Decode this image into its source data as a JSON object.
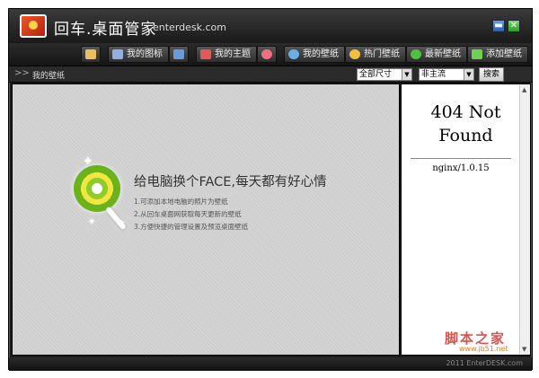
{
  "app": {
    "title": "回车.桌面管家",
    "domain": "enterdesk.com",
    "minimize_label": "▬",
    "close_label": "✕"
  },
  "toolbar": {
    "buttons": [
      {
        "label": "",
        "icon": "folder-icon",
        "color": "#e8c060"
      },
      {
        "label": "我的图标",
        "icon": "grid-icon",
        "color": "#8fb0e0"
      },
      {
        "label": "",
        "icon": "image-icon",
        "color": "#6a9ad8"
      },
      {
        "label": "我的主题",
        "icon": "palette-icon",
        "color": "#e05a5a"
      },
      {
        "label": "",
        "icon": "heart-icon",
        "color": "#f07080"
      },
      {
        "label": "我的壁纸",
        "icon": "user-icon",
        "color": "#6ab0e8"
      },
      {
        "label": "热门壁纸",
        "icon": "medal-icon",
        "color": "#f0c040"
      },
      {
        "label": "最新壁纸",
        "icon": "refresh-icon",
        "color": "#50c040"
      },
      {
        "label": "添加壁纸",
        "icon": "plus-icon",
        "color": "#70d050"
      }
    ]
  },
  "subbar": {
    "breadcrumb": "我的壁纸",
    "size_select": "全部尺寸",
    "theme_select": "非主流",
    "search_label": "搜索"
  },
  "main": {
    "headline": "给电脑换个FACE,每天都有好心情",
    "tips": [
      "1.可添加本地电脑的照片为壁纸",
      "2.从回车桌面网获取每天更新的壁纸",
      "3.方便快捷的管理设置及预览桌面壁纸"
    ]
  },
  "side": {
    "error_title_line1": "404 Not",
    "error_title_line2": "Found",
    "server": "nginx/1.0.15",
    "watermark_cn": "脚本之家",
    "watermark_url": "www.jb51.net"
  },
  "status": {
    "copyright": "2011 EnterDESK.com"
  }
}
